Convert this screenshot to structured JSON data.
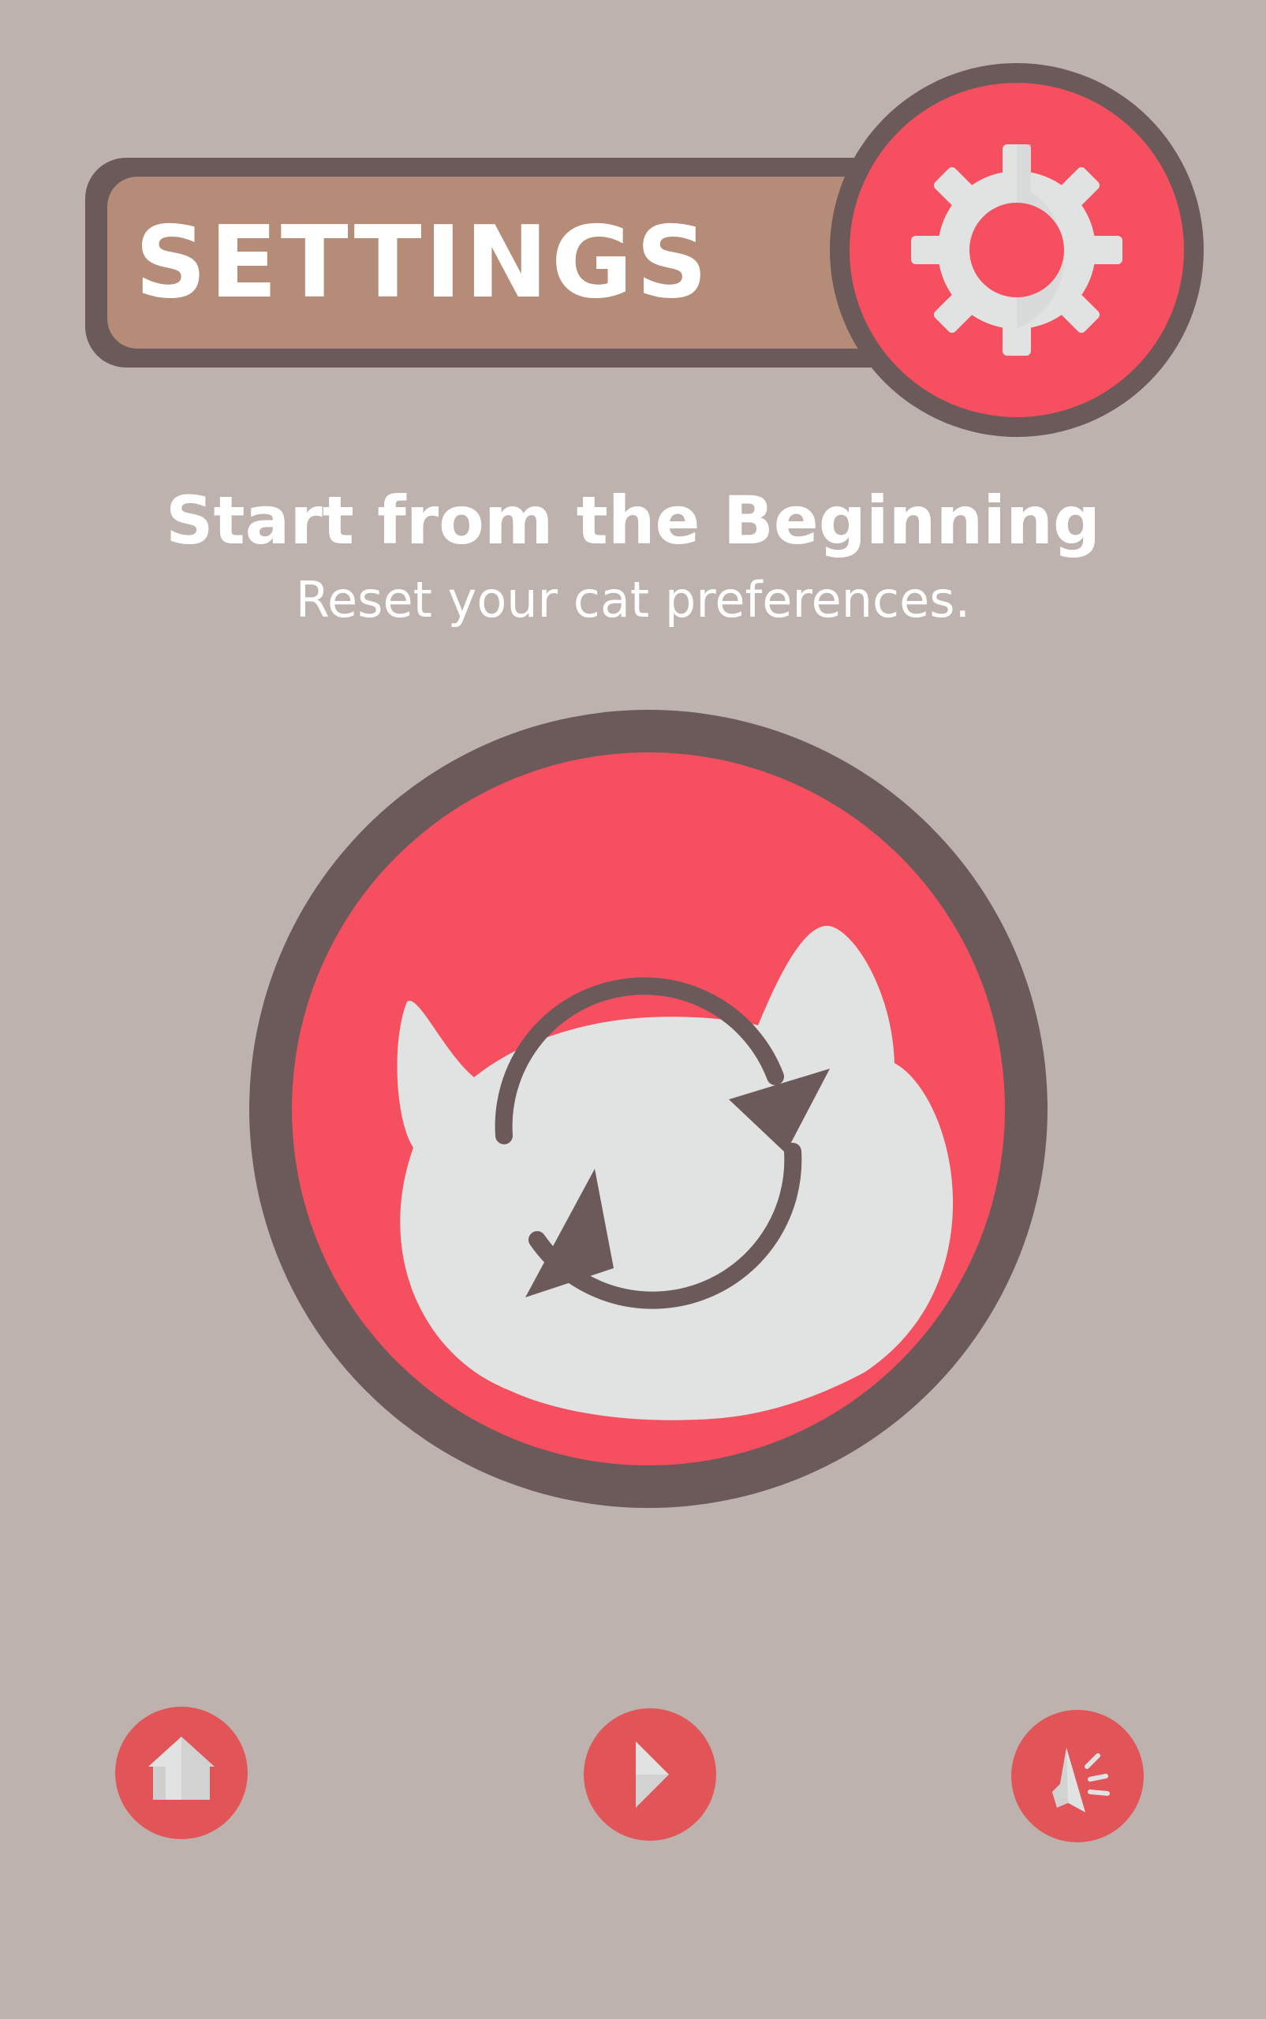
{
  "header": {
    "title": "SETTINGS",
    "icon": "gear-icon"
  },
  "reset_section": {
    "heading": "Start from the Beginning",
    "subheading": "Reset your cat preferences.",
    "button_icon": "cat-refresh-icon"
  },
  "bottom_nav": {
    "items": [
      {
        "id": "home",
        "icon": "home-icon"
      },
      {
        "id": "play",
        "icon": "play-icon"
      },
      {
        "id": "sound",
        "icon": "megaphone-icon"
      }
    ]
  },
  "colors": {
    "background": "#bdb2ad",
    "outline": "#6c5a5b",
    "banner": "#b48c78",
    "accent_red": "#f64f5f",
    "nav_red": "#e15558",
    "icon_light": "#e1e2e2",
    "text": "#ffffff"
  }
}
